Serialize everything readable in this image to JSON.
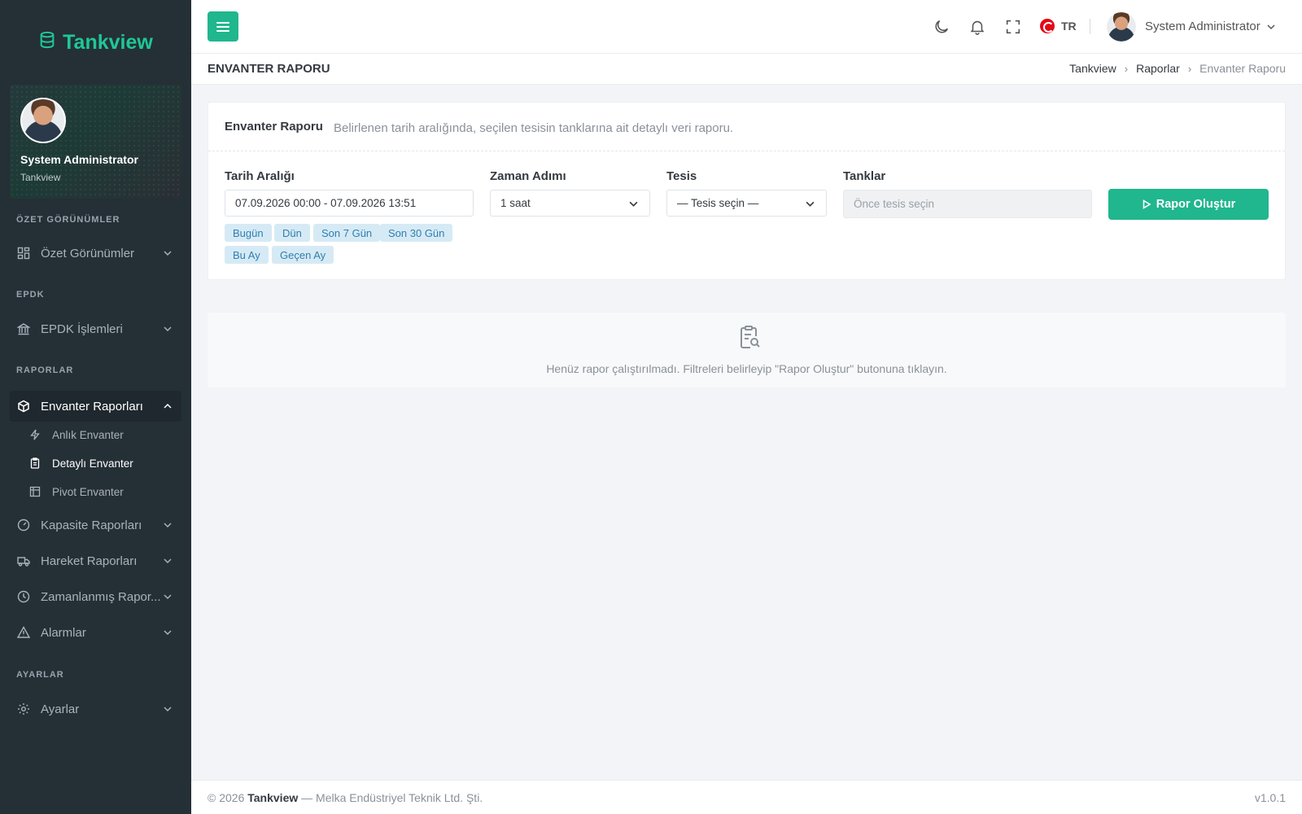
{
  "brand": {
    "name": "Tankview",
    "color": "#1ec796"
  },
  "sidebar": {
    "user": {
      "name": "System Administrator",
      "org": "Tankview"
    },
    "sections": [
      {
        "title": "ÖZET GÖRÜNÜMLER"
      },
      {
        "title": "EPDK"
      },
      {
        "title": "RAPORLAR"
      },
      {
        "title": "AYARLAR"
      }
    ],
    "items": [
      {
        "label": "Özet Görünümler",
        "icon": "dashboard-icon"
      },
      {
        "label": "EPDK İşlemleri",
        "icon": "bank-icon"
      },
      {
        "label": "Envanter Raporları",
        "icon": "cube-icon",
        "expanded": true
      },
      {
        "label": "Kapasite Raporları",
        "icon": "gauge-icon"
      },
      {
        "label": "Hareket Raporları",
        "icon": "truck-icon"
      },
      {
        "label": "Zamanlanmış Rapor...",
        "icon": "clock-icon"
      },
      {
        "label": "Alarmlar",
        "icon": "warning-icon"
      },
      {
        "label": "Ayarlar",
        "icon": "gear-icon"
      }
    ],
    "subitems": [
      {
        "label": "Anlık Envanter",
        "icon": "bolt-icon"
      },
      {
        "label": "Detaylı Envanter",
        "icon": "clipboard-icon",
        "active": true
      },
      {
        "label": "Pivot Envanter",
        "icon": "table-icon"
      }
    ]
  },
  "topbar": {
    "lang": "TR",
    "user": "System Administrator"
  },
  "page": {
    "title": "ENVANTER RAPORU",
    "breadcrumb": [
      "Tankview",
      "Raporlar",
      "Envanter Raporu"
    ]
  },
  "filter": {
    "title": "Envanter Raporu",
    "description": "Belirlenen tarih aralığında, seçilen tesisin tanklarına ait detaylı veri raporu.",
    "date_label": "Tarih Aralığı",
    "date_value": "07.09.2026 00:00 - 07.09.2026 13:51",
    "step_label": "Zaman Adımı",
    "step_value": "1 saat",
    "facility_label": "Tesis",
    "facility_value": "— Tesis seçin —",
    "tanks_label": "Tanklar",
    "tanks_placeholder": "Önce tesis seçin",
    "quick_ranges": [
      "Bugün",
      "Dün",
      "Son 7 Gün",
      "Son 30 Gün",
      "Bu Ay",
      "Geçen Ay"
    ],
    "run_label": "Rapor Oluştur"
  },
  "empty": {
    "text": "Henüz rapor çalıştırılmadı. Filtreleri belirleyip \"Rapor Oluştur\" butonuna tıklayın."
  },
  "footer": {
    "copyright": "© 2026",
    "company_brand": "Tankview",
    "company": "— Melka Endüstriyel Teknik Ltd. Şti.",
    "version": "v1.0.1"
  },
  "colors": {
    "accent": "#20b68e",
    "sidebar_bg": "#252f36",
    "chip_bg": "#d6eaf5",
    "chip_text": "#2f7fb0"
  }
}
